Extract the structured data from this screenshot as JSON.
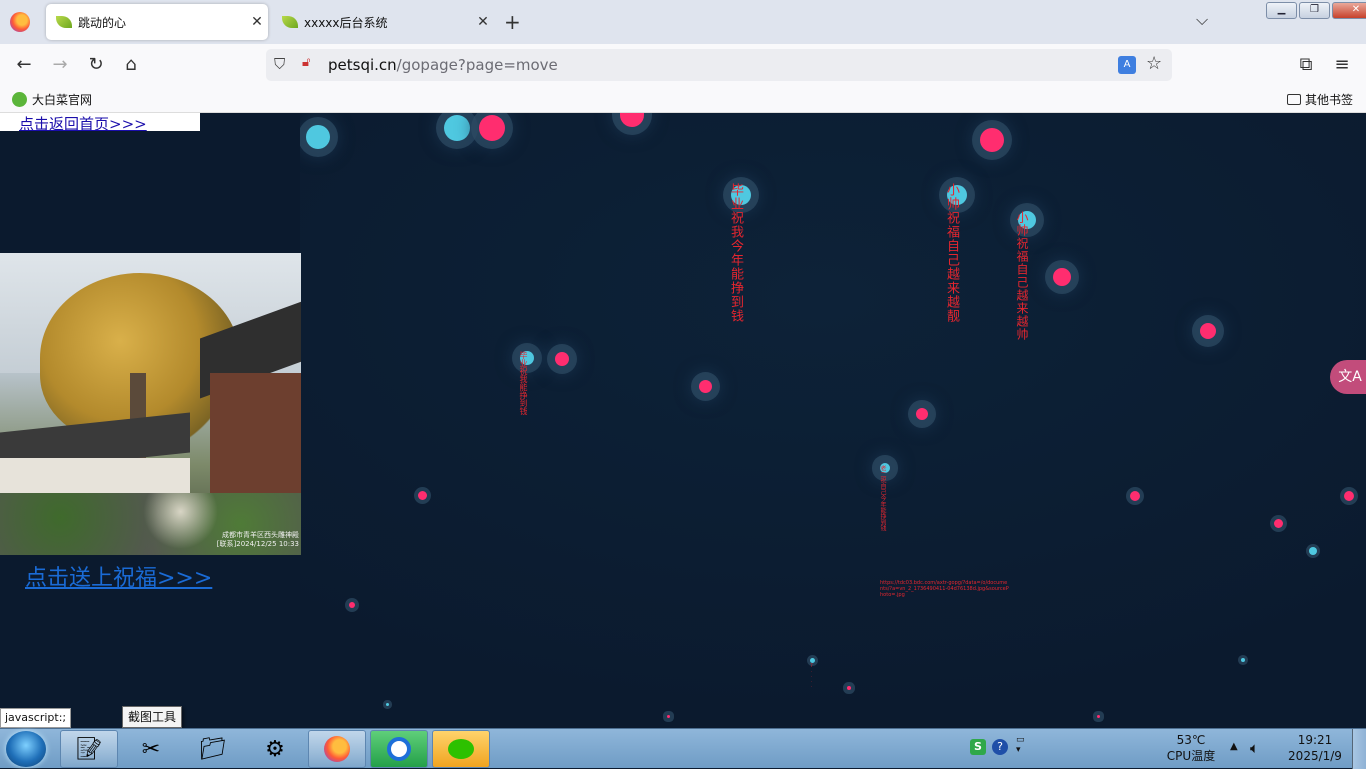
{
  "browser": {
    "tabs": [
      {
        "title": "跳动的心",
        "active": true
      },
      {
        "title": "xxxxx后台系统",
        "active": false
      }
    ],
    "new_tab_label": "+",
    "tab_list_glyph": "⌵",
    "window_buttons": {
      "minimize": "▁",
      "restore": "❐",
      "close": "✕"
    },
    "url_host": "petsqi.cn",
    "url_path": "/gopage?page=move",
    "bookmarks": {
      "left": "大白菜官网",
      "right": "其他书签"
    }
  },
  "page": {
    "home_link": "点击返回首页>>>",
    "bless_link": "点击送上祝福>>>",
    "photo_caption_line1": "成都市青羊区西头雕神殿",
    "photo_caption_line2": "[联系]2024/12/25 10:33",
    "wishes": {
      "w1": "毕业祝我今年能挣到钱",
      "w2": "小帅祝福自己越来越靓",
      "w3": "小帅祝福自己越来越帅",
      "w4": "毕业祝我能挣到钱",
      "w5": "老二祝自己今年能挣到钱",
      "w6": "7...."
    },
    "long_message_text": "https://tdc03.bdc.com/axtr-gopg/?data=/o/documents/?a=vn_2_1736490411-04d76138d.jpg&sourcePhoto=.jpg",
    "translate_float": "文A"
  },
  "status_url": "javascript:;",
  "tooltip": "截图工具",
  "taskbar": {
    "cpu_temp": "53℃",
    "cpu_label": "CPU温度",
    "time": "19:21",
    "date": "2025/1/9",
    "tray_s": "S",
    "tray_help": "?"
  },
  "colors": {
    "background": "#0b1a2e",
    "orb_pink": "#ff2d6f",
    "orb_cyan": "#4fc8e0",
    "wish_text": "#e5262f",
    "link": "#1a6bd6"
  },
  "icons": [
    "firefox-icon",
    "leaf-icon",
    "close-icon",
    "back-icon",
    "forward-icon",
    "reload-icon",
    "home-icon",
    "shield-icon",
    "lock-icon",
    "translate-icon",
    "star-icon",
    "extensions-icon",
    "menu-icon",
    "folder-icon",
    "start-icon",
    "notepad-icon",
    "snipping-tool-icon",
    "explorer-icon",
    "settings-icon",
    "browser-icon",
    "wechat-icon",
    "volume-icon"
  ]
}
